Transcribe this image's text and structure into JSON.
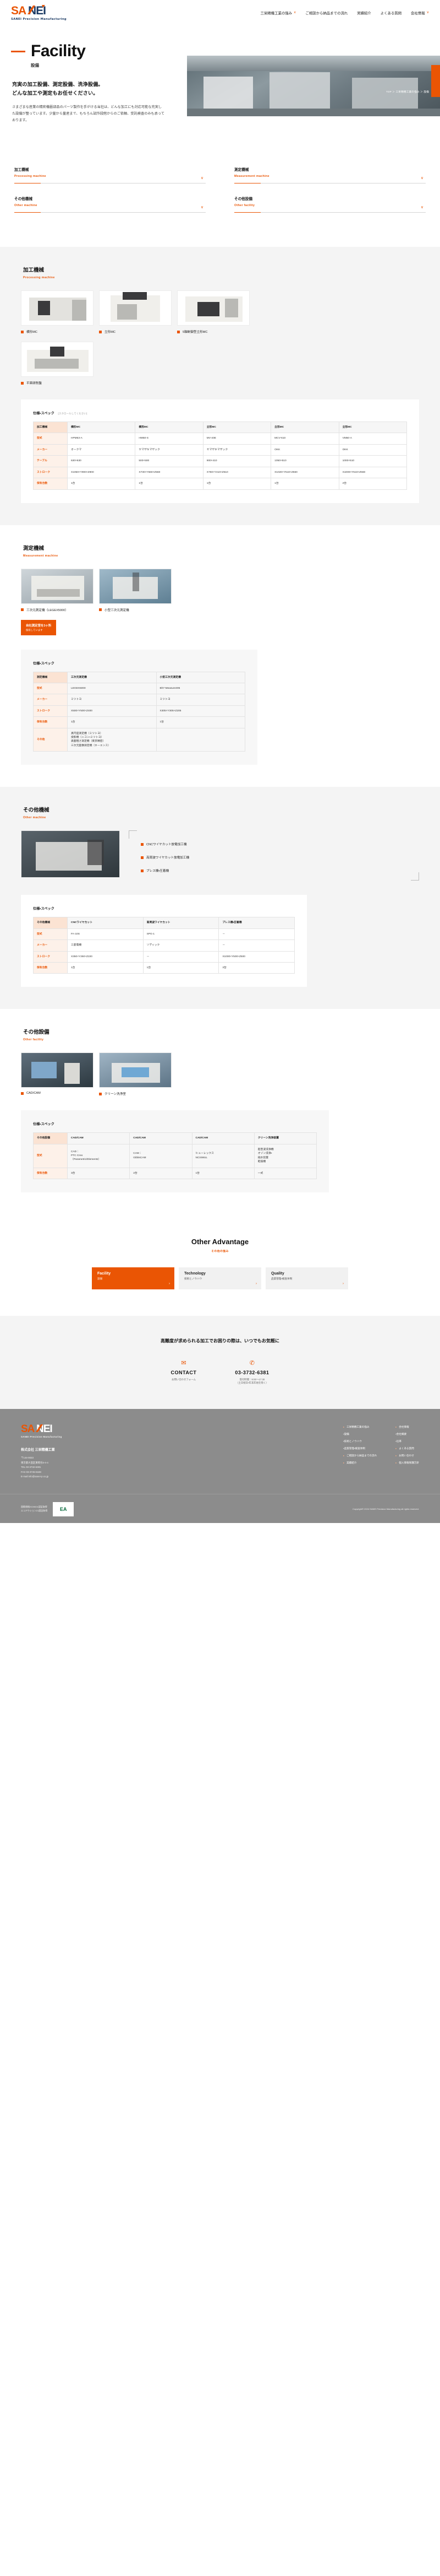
{
  "header": {
    "logo_text": "SANEI",
    "logo_sub": "SANEI Precision Manufacturing",
    "nav": [
      {
        "label": "三栄精機工業の強み",
        "caret": "chevron-down-icon",
        "has_caret": true
      },
      {
        "label": "ご相談から納品までの流れ",
        "has_caret": false
      },
      {
        "label": "実績紹介",
        "has_caret": false
      },
      {
        "label": "よくある質問",
        "has_caret": false
      },
      {
        "label": "会社情報",
        "caret": "chevron-down-icon",
        "has_caret": true
      }
    ]
  },
  "hero": {
    "title": "Facility",
    "subtitle": "設備",
    "lead_line1": "充実の加工設備、測定設備、洗浄設備。",
    "lead_line2": "どんな加工や測定もお任せください。",
    "body": "さまざまな産業の精密機器部品のパーツ製作を手がける当社は、どんな加工にも対応可能な充実した設備が整っています。少量から量産まで、もちろん試作段階からのご依頼、受託検査のみも承っております。",
    "breadcrumb": "TOP ＞ 三栄精機工業の強み ＞ 設備"
  },
  "anchors": [
    {
      "ja": "加工機械",
      "en": "Processing machine"
    },
    {
      "ja": "測定機械",
      "en": "Measurement machine"
    },
    {
      "ja": "その他機械",
      "en": "Other machine"
    },
    {
      "ja": "その他設備",
      "en": "Other facility"
    }
  ],
  "sections": {
    "processing": {
      "ja": "加工機械",
      "en": "Processing machine",
      "photos": [
        {
          "caption": "横形MC"
        },
        {
          "caption": "立形MC"
        },
        {
          "caption": "5軸制御型立形MC"
        },
        {
          "caption": "平面研削盤"
        }
      ],
      "spec_title": "仕様・スペック",
      "spec_note": "[スクロールしてください]",
      "table": {
        "headers": [
          "加工機械",
          "横形MC",
          "横形MC",
          "立形MC",
          "立形MC",
          "立形MC"
        ],
        "rows": [
          {
            "label": "型式",
            "cells": [
              "HPM63-A",
              "HM50-S",
              "MV-40E",
              "MCV-610",
              "VM50-A"
            ]
          },
          {
            "label": "メーカー",
            "cells": [
              "オークマ",
              "ヤマザキマザック",
              "ヤマザキマザック",
              "OKK",
              "OKK"
            ]
          },
          {
            "label": "テーブル",
            "cells": [
              "630×630",
              "500×500",
              "900×410",
              "1050×510",
              "1000×510"
            ]
          },
          {
            "label": "ストローク",
            "cells": [
              "X1050×Y900×Z900",
              "X730×Y560×Z560",
              "X760×Y410×Z510",
              "X1020×Y510×Z560",
              "X1000×Y510×Z560"
            ]
          },
          {
            "label": "保有台数",
            "cells": [
              "1台",
              "1台",
              "1台",
              "1台",
              "2台"
            ]
          }
        ]
      }
    },
    "measurement": {
      "ja": "測定機械",
      "en": "Measurement machine",
      "photos": [
        {
          "caption": "三次元測定機（LEGEX5000）"
        },
        {
          "caption": "小型三次元測定機"
        }
      ],
      "highlight_l1": "自社測定室を3ヶ所",
      "highlight_l2": "保有しています",
      "spec_title": "仕様・スペック",
      "table": {
        "headers": [
          "測定機械",
          "三次元測定機",
          "小型三次元測定機"
        ],
        "rows": [
          {
            "label": "型式",
            "cells": [
              "LEGEX5000",
              "Bh7-Measure305"
            ]
          },
          {
            "label": "メーカー",
            "cells": [
              "ミツトヨ",
              "ミツトヨ"
            ]
          },
          {
            "label": "ストローク",
            "cells": [
              "X500×Y500×Z400",
              "X305×Y305×Z205"
            ]
          },
          {
            "label": "保有台数",
            "cells": [
              "1台",
              "1台"
            ]
          },
          {
            "label": "その他",
            "cells": [
              "真円度測定機（ミツトヨ）\n投影機（ニコン・ミツトヨ）\n表面粗さ測定機（東京精密）\n三次元画像測定機（キーエンス）",
              ""
            ]
          }
        ]
      }
    },
    "other_machine": {
      "ja": "その他機械",
      "en": "Other machine",
      "items": [
        "CNCワイヤカット放電加工機",
        "高周波ワイヤカット放電加工機",
        "プレス機・圧着機"
      ],
      "spec_title": "仕様・スペック",
      "table": {
        "headers": [
          "その他機械",
          "CNCワイヤカット",
          "高周波ワイヤカット",
          "プレス機・圧着機"
        ],
        "rows": [
          {
            "label": "型式",
            "cells": [
              "FA-10S",
              "SPG-1",
              "－"
            ]
          },
          {
            "label": "メーカー",
            "cells": [
              "三菱電機",
              "ソディック",
              "－"
            ]
          },
          {
            "label": "ストローク",
            "cells": [
              "X350×Y250×Z220",
              "－",
              "X1000×Y500×Z500"
            ]
          },
          {
            "label": "保有台数",
            "cells": [
              "1台",
              "1台",
              "3台"
            ]
          }
        ]
      }
    },
    "other_facility": {
      "ja": "その他設備",
      "en": "Other facility",
      "photos": [
        {
          "caption": "CAD/CAM"
        },
        {
          "caption": "クリーン洗浄室"
        }
      ],
      "spec_title": "仕様・スペック",
      "table": {
        "headers": [
          "その他設備",
          "CAD/CAM",
          "CAD/CAM",
          "CAD/CAM",
          "クリーン洗浄装置"
        ],
        "rows": [
          {
            "label": "型式",
            "cells": [
              "CAD：\nPTC Creo\n（Parametric/Elements）",
              "CAM：\nGibbsCAM",
              "ヒューレックス\nNCSIMUL",
              "超音波洗浄機\nオゾン洗浄・\n純水装置\n乾燥機"
            ]
          },
          {
            "label": "保有台数",
            "cells": [
              "3台",
              "2台",
              "1台",
              "一式"
            ]
          }
        ]
      }
    }
  },
  "advantage": {
    "title": "Other Advantage",
    "subtitle": "その他の強み",
    "cards": [
      {
        "en": "Facility",
        "ja": "設備",
        "active": true
      },
      {
        "en": "Technology",
        "ja": "技術とノウハウ",
        "active": false
      },
      {
        "en": "Quality",
        "ja": "品質管理・検査体制",
        "active": false
      }
    ]
  },
  "contact": {
    "lead": "高難度が求められる加工でお困りの際は、いつでもお気軽に",
    "mail_icon": "envelope-icon",
    "mail_label": "CONTACT",
    "mail_sub": "お問い合わせフォーム",
    "tel_icon": "phone-icon",
    "tel_label": "03-3732-6381",
    "tel_sub": "受付時間：9:00〜17:30\n（土日祝日・年末年始を除く）"
  },
  "footer": {
    "logo_text": "SANEI",
    "logo_sub": "SANEI Precision Manufacturing",
    "company": "株式会社 三栄精機工業",
    "address": "〒144-0033\n東京都大田区東糀谷3-4-4\nTEL 03-3732-6381\nFAX 03-3745-5348\nE-mail info@sanei-p.co.jp",
    "nav_col1": [
      "三栄精機工業の強み",
      "・設備",
      "・技術とノウハウ",
      "・品質管理・検査体制",
      "ご相談から納品までの流れ",
      "実績紹介"
    ],
    "nav_col2": [
      "会社情報",
      "・会社概要",
      "・沿革",
      "よくある質問",
      "お問い合わせ",
      "個人情報保護方針"
    ],
    "cert_text": "国際規格ISO9001認証取得\nエコアクション21認証取得",
    "cert_badge": "EA",
    "copyright": "Copyright© 2024 SANEI Precision Manufacturing all rights reserved."
  }
}
